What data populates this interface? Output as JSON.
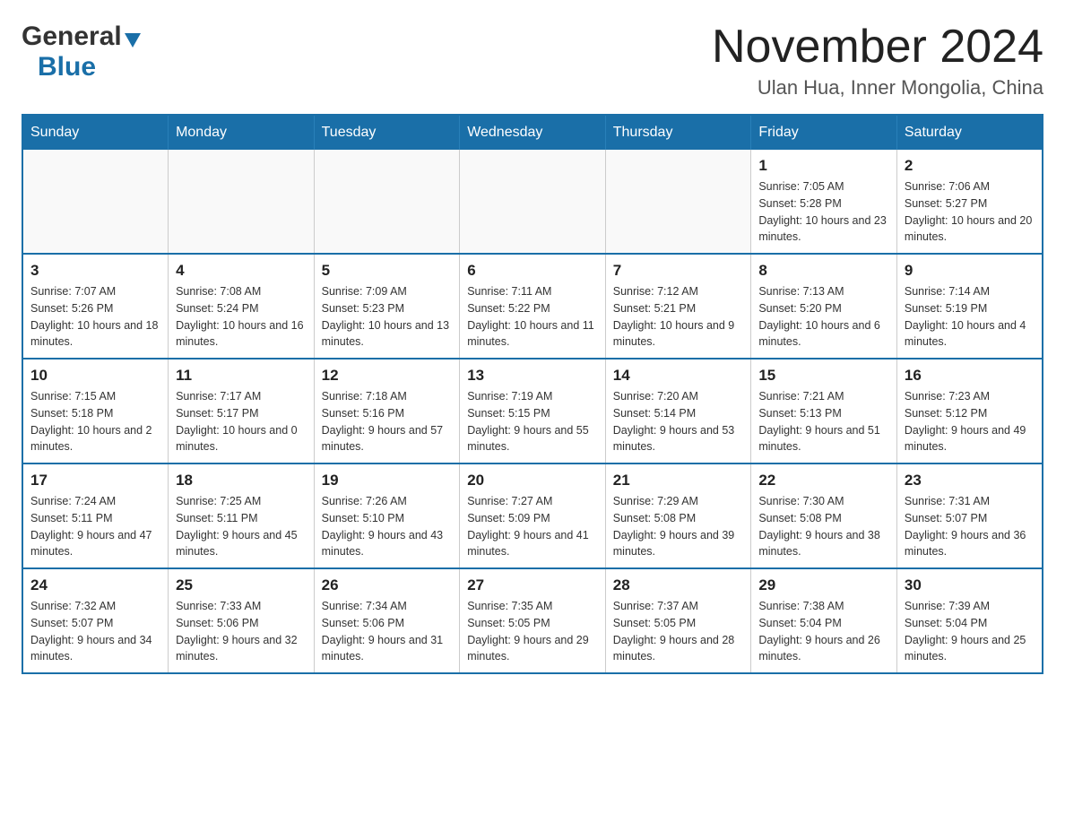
{
  "logo": {
    "general": "General",
    "blue": "Blue"
  },
  "title": "November 2024",
  "subtitle": "Ulan Hua, Inner Mongolia, China",
  "weekdays": [
    "Sunday",
    "Monday",
    "Tuesday",
    "Wednesday",
    "Thursday",
    "Friday",
    "Saturday"
  ],
  "weeks": [
    [
      {
        "day": "",
        "info": ""
      },
      {
        "day": "",
        "info": ""
      },
      {
        "day": "",
        "info": ""
      },
      {
        "day": "",
        "info": ""
      },
      {
        "day": "",
        "info": ""
      },
      {
        "day": "1",
        "info": "Sunrise: 7:05 AM\nSunset: 5:28 PM\nDaylight: 10 hours and 23 minutes."
      },
      {
        "day": "2",
        "info": "Sunrise: 7:06 AM\nSunset: 5:27 PM\nDaylight: 10 hours and 20 minutes."
      }
    ],
    [
      {
        "day": "3",
        "info": "Sunrise: 7:07 AM\nSunset: 5:26 PM\nDaylight: 10 hours and 18 minutes."
      },
      {
        "day": "4",
        "info": "Sunrise: 7:08 AM\nSunset: 5:24 PM\nDaylight: 10 hours and 16 minutes."
      },
      {
        "day": "5",
        "info": "Sunrise: 7:09 AM\nSunset: 5:23 PM\nDaylight: 10 hours and 13 minutes."
      },
      {
        "day": "6",
        "info": "Sunrise: 7:11 AM\nSunset: 5:22 PM\nDaylight: 10 hours and 11 minutes."
      },
      {
        "day": "7",
        "info": "Sunrise: 7:12 AM\nSunset: 5:21 PM\nDaylight: 10 hours and 9 minutes."
      },
      {
        "day": "8",
        "info": "Sunrise: 7:13 AM\nSunset: 5:20 PM\nDaylight: 10 hours and 6 minutes."
      },
      {
        "day": "9",
        "info": "Sunrise: 7:14 AM\nSunset: 5:19 PM\nDaylight: 10 hours and 4 minutes."
      }
    ],
    [
      {
        "day": "10",
        "info": "Sunrise: 7:15 AM\nSunset: 5:18 PM\nDaylight: 10 hours and 2 minutes."
      },
      {
        "day": "11",
        "info": "Sunrise: 7:17 AM\nSunset: 5:17 PM\nDaylight: 10 hours and 0 minutes."
      },
      {
        "day": "12",
        "info": "Sunrise: 7:18 AM\nSunset: 5:16 PM\nDaylight: 9 hours and 57 minutes."
      },
      {
        "day": "13",
        "info": "Sunrise: 7:19 AM\nSunset: 5:15 PM\nDaylight: 9 hours and 55 minutes."
      },
      {
        "day": "14",
        "info": "Sunrise: 7:20 AM\nSunset: 5:14 PM\nDaylight: 9 hours and 53 minutes."
      },
      {
        "day": "15",
        "info": "Sunrise: 7:21 AM\nSunset: 5:13 PM\nDaylight: 9 hours and 51 minutes."
      },
      {
        "day": "16",
        "info": "Sunrise: 7:23 AM\nSunset: 5:12 PM\nDaylight: 9 hours and 49 minutes."
      }
    ],
    [
      {
        "day": "17",
        "info": "Sunrise: 7:24 AM\nSunset: 5:11 PM\nDaylight: 9 hours and 47 minutes."
      },
      {
        "day": "18",
        "info": "Sunrise: 7:25 AM\nSunset: 5:11 PM\nDaylight: 9 hours and 45 minutes."
      },
      {
        "day": "19",
        "info": "Sunrise: 7:26 AM\nSunset: 5:10 PM\nDaylight: 9 hours and 43 minutes."
      },
      {
        "day": "20",
        "info": "Sunrise: 7:27 AM\nSunset: 5:09 PM\nDaylight: 9 hours and 41 minutes."
      },
      {
        "day": "21",
        "info": "Sunrise: 7:29 AM\nSunset: 5:08 PM\nDaylight: 9 hours and 39 minutes."
      },
      {
        "day": "22",
        "info": "Sunrise: 7:30 AM\nSunset: 5:08 PM\nDaylight: 9 hours and 38 minutes."
      },
      {
        "day": "23",
        "info": "Sunrise: 7:31 AM\nSunset: 5:07 PM\nDaylight: 9 hours and 36 minutes."
      }
    ],
    [
      {
        "day": "24",
        "info": "Sunrise: 7:32 AM\nSunset: 5:07 PM\nDaylight: 9 hours and 34 minutes."
      },
      {
        "day": "25",
        "info": "Sunrise: 7:33 AM\nSunset: 5:06 PM\nDaylight: 9 hours and 32 minutes."
      },
      {
        "day": "26",
        "info": "Sunrise: 7:34 AM\nSunset: 5:06 PM\nDaylight: 9 hours and 31 minutes."
      },
      {
        "day": "27",
        "info": "Sunrise: 7:35 AM\nSunset: 5:05 PM\nDaylight: 9 hours and 29 minutes."
      },
      {
        "day": "28",
        "info": "Sunrise: 7:37 AM\nSunset: 5:05 PM\nDaylight: 9 hours and 28 minutes."
      },
      {
        "day": "29",
        "info": "Sunrise: 7:38 AM\nSunset: 5:04 PM\nDaylight: 9 hours and 26 minutes."
      },
      {
        "day": "30",
        "info": "Sunrise: 7:39 AM\nSunset: 5:04 PM\nDaylight: 9 hours and 25 minutes."
      }
    ]
  ]
}
